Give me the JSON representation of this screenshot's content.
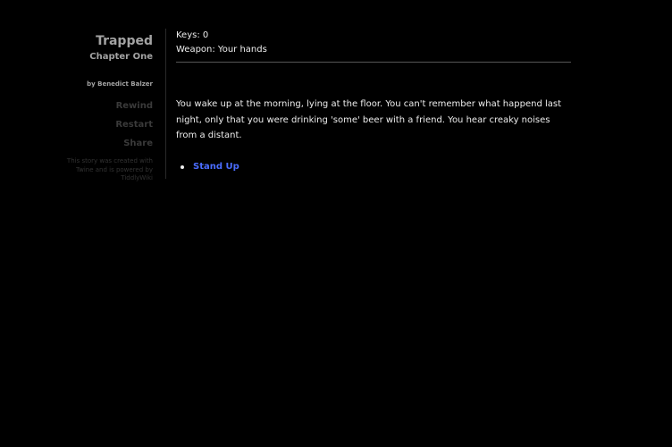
{
  "sidebar": {
    "title": "Trapped",
    "subtitle": "Chapter One",
    "author": "by Benedict Balzer",
    "menu": [
      {
        "label": "Rewind"
      },
      {
        "label": "Restart"
      },
      {
        "label": "Share"
      }
    ],
    "credits": "This story was created with Twine and is powered by TiddlyWiki"
  },
  "status": {
    "keys": "Keys: 0",
    "weapon": "Weapon: Your hands"
  },
  "passage": {
    "text": "You wake up at the morning, lying at the floor. You can't remember what happend last night, only that you were drinking 'some' beer with a friend. You hear creaky noises from a distant.",
    "choices": [
      {
        "label": "Stand Up"
      }
    ]
  },
  "colors": {
    "background": "#000000",
    "text": "#eeeeee",
    "link": "#4a6cff",
    "sidebar_text": "#a3a3a3",
    "menu_text": "#3a3a3a"
  }
}
